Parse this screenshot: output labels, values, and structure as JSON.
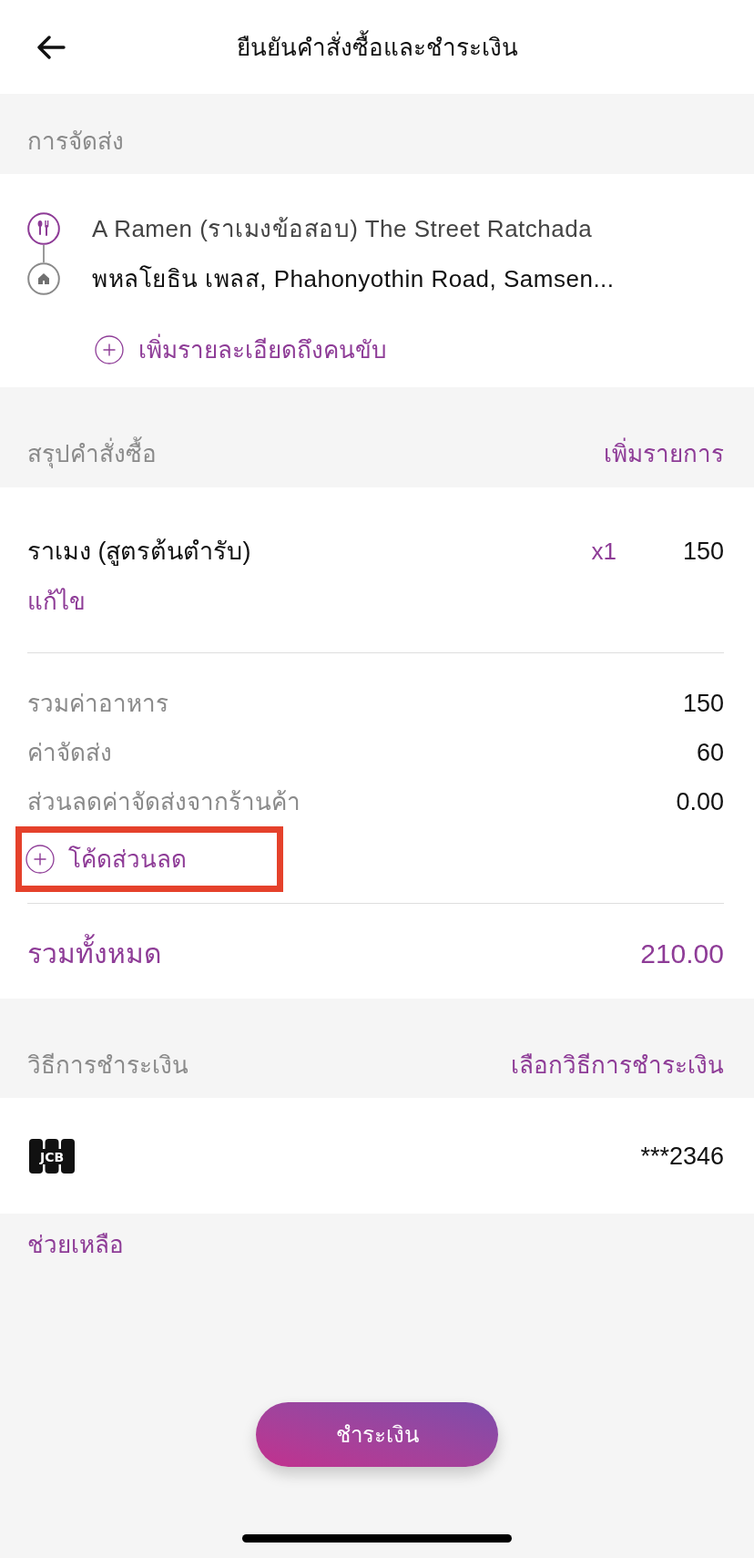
{
  "header": {
    "title": "ยืนยันคำสั่งซื้อและชำระเงิน"
  },
  "delivery": {
    "heading": "การจัดส่ง",
    "stops": [
      {
        "kind": "restaurant",
        "text": "A Ramen (ราเมงข้อสอบ) The Street Ratchada"
      },
      {
        "kind": "home",
        "text": "พหลโยธิน เพลส, Phahonyothin Road, Samsen..."
      }
    ],
    "add_note": "เพิ่มรายละเอียดถึงคนขับ"
  },
  "order_summary": {
    "heading": "สรุปคำสั่งซื้อ",
    "action": "เพิ่มรายการ",
    "items": [
      {
        "name": "ราเมง (สูตรต้นตำรับ)",
        "quantity": "x1",
        "price": "150",
        "edit": "แก้ไข"
      }
    ],
    "charges": [
      {
        "label": "รวมค่าอาหาร",
        "amount": "150"
      },
      {
        "label": "ค่าจัดส่ง",
        "amount": "60"
      },
      {
        "label": "ส่วนลดค่าจัดส่งจากร้านค้า",
        "amount": "0.00"
      }
    ],
    "promo_code": {
      "label": "โค้ดส่วนลด",
      "highlighted": true
    },
    "total": {
      "label": "รวมทั้งหมด",
      "amount": "210.00"
    }
  },
  "payment": {
    "heading": "วิธีการชำระเงิน",
    "action": "เลือกวิธีการชำระเงิน",
    "card": {
      "logo_text": "JCB",
      "number": "***2346"
    }
  },
  "help_link": "ช่วยเหลือ",
  "pay_button": "ชำระเงิน"
}
